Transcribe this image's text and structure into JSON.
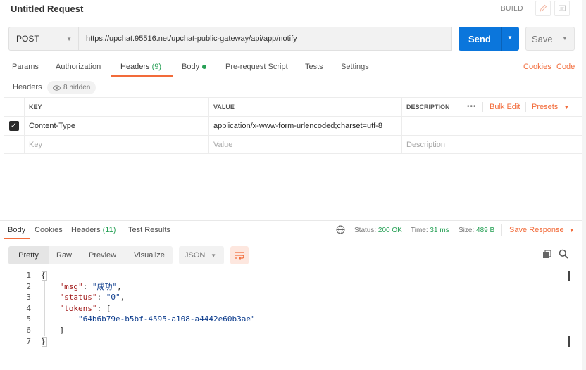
{
  "window": {
    "title": "Untitled Request",
    "build_label": "BUILD"
  },
  "request": {
    "method": "POST",
    "url": "https://upchat.95516.net/upchat-public-gateway/api/app/notify",
    "send_label": "Send",
    "save_label": "Save"
  },
  "request_tabs": {
    "params": "Params",
    "authorization": "Authorization",
    "headers": "Headers",
    "headers_count": "(9)",
    "body": "Body",
    "prerequest": "Pre-request Script",
    "tests": "Tests",
    "settings": "Settings",
    "cookies": "Cookies",
    "code": "Code"
  },
  "headers_section": {
    "label": "Headers",
    "hidden": "8 hidden"
  },
  "headers_table": {
    "columns": {
      "key": "KEY",
      "value": "VALUE",
      "description": "DESCRIPTION"
    },
    "bulk_edit": "Bulk Edit",
    "presets": "Presets",
    "rows": [
      {
        "checked": true,
        "key": "Content-Type",
        "value": "application/x-www-form-urlencoded;charset=utf-8",
        "description": ""
      }
    ],
    "placeholder": {
      "key": "Key",
      "value": "Value",
      "description": "Description"
    }
  },
  "response": {
    "tabs": {
      "body": "Body",
      "cookies": "Cookies",
      "headers": "Headers",
      "headers_count": "(11)",
      "test_results": "Test Results"
    },
    "status_label": "Status:",
    "status": "200 OK",
    "time_label": "Time:",
    "time": "31 ms",
    "size_label": "Size:",
    "size": "489 B",
    "save_response": "Save Response",
    "view_modes": {
      "pretty": "Pretty",
      "raw": "Raw",
      "preview": "Preview",
      "visualize": "Visualize"
    },
    "format": "JSON",
    "lines": [
      {
        "n": "1"
      },
      {
        "n": "2",
        "key": "\"msg\"",
        "val": "\"成功\""
      },
      {
        "n": "3",
        "key": "\"status\"",
        "val": "\"0\""
      },
      {
        "n": "4",
        "key": "\"tokens\""
      },
      {
        "n": "5",
        "val": "\"64b6b79e-b5bf-4595-a108-a4442e60b3ae\""
      },
      {
        "n": "6"
      },
      {
        "n": "7"
      }
    ]
  },
  "colors": {
    "accent": "#f26b3a",
    "send": "#0b76dc",
    "success": "#26a055"
  }
}
